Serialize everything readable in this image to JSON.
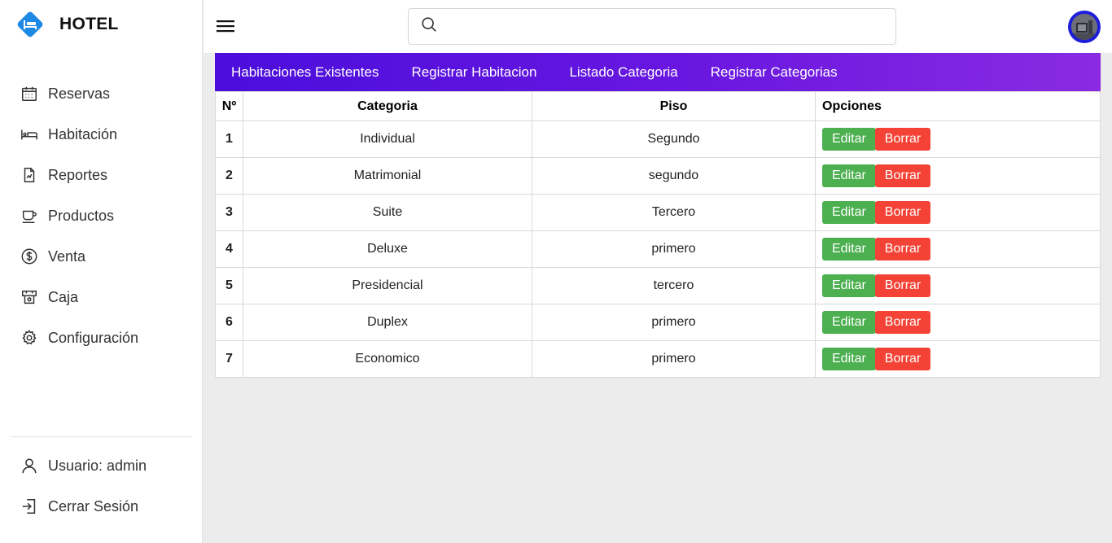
{
  "app": {
    "title": "HOTEL"
  },
  "colors": {
    "accent_start": "#4b0edc",
    "accent_end": "#8a2be2",
    "edit": "#4caf50",
    "delete": "#f44336",
    "logo": "#1e88e5"
  },
  "sidebar": {
    "items": [
      {
        "label": "Reservas",
        "icon": "calendar-icon"
      },
      {
        "label": "Habitación",
        "icon": "bed-icon"
      },
      {
        "label": "Reportes",
        "icon": "report-icon"
      },
      {
        "label": "Productos",
        "icon": "cup-icon"
      },
      {
        "label": "Venta",
        "icon": "dollar-icon"
      },
      {
        "label": "Caja",
        "icon": "cash-register-icon"
      },
      {
        "label": "Configuración",
        "icon": "gear-icon"
      }
    ],
    "bottom": [
      {
        "label": "Usuario: admin",
        "icon": "user-icon"
      },
      {
        "label": "Cerrar Sesión",
        "icon": "logout-icon"
      }
    ]
  },
  "search": {
    "placeholder": ""
  },
  "tabs": [
    {
      "label": "Habitaciones Existentes"
    },
    {
      "label": "Registrar Habitacion"
    },
    {
      "label": "Listado Categoria"
    },
    {
      "label": "Registrar Categorias"
    }
  ],
  "table": {
    "headers": {
      "num": "Nº",
      "categoria": "Categoria",
      "piso": "Piso",
      "opciones": "Opciones"
    },
    "edit_label": "Editar",
    "delete_label": "Borrar",
    "rows": [
      {
        "num": "1",
        "categoria": "Individual",
        "piso": "Segundo"
      },
      {
        "num": "2",
        "categoria": "Matrimonial",
        "piso": "segundo"
      },
      {
        "num": "3",
        "categoria": "Suite",
        "piso": "Tercero"
      },
      {
        "num": "4",
        "categoria": "Deluxe",
        "piso": "primero"
      },
      {
        "num": "5",
        "categoria": "Presidencial",
        "piso": "tercero"
      },
      {
        "num": "6",
        "categoria": "Duplex",
        "piso": "primero"
      },
      {
        "num": "7",
        "categoria": "Economico",
        "piso": "primero"
      }
    ]
  }
}
